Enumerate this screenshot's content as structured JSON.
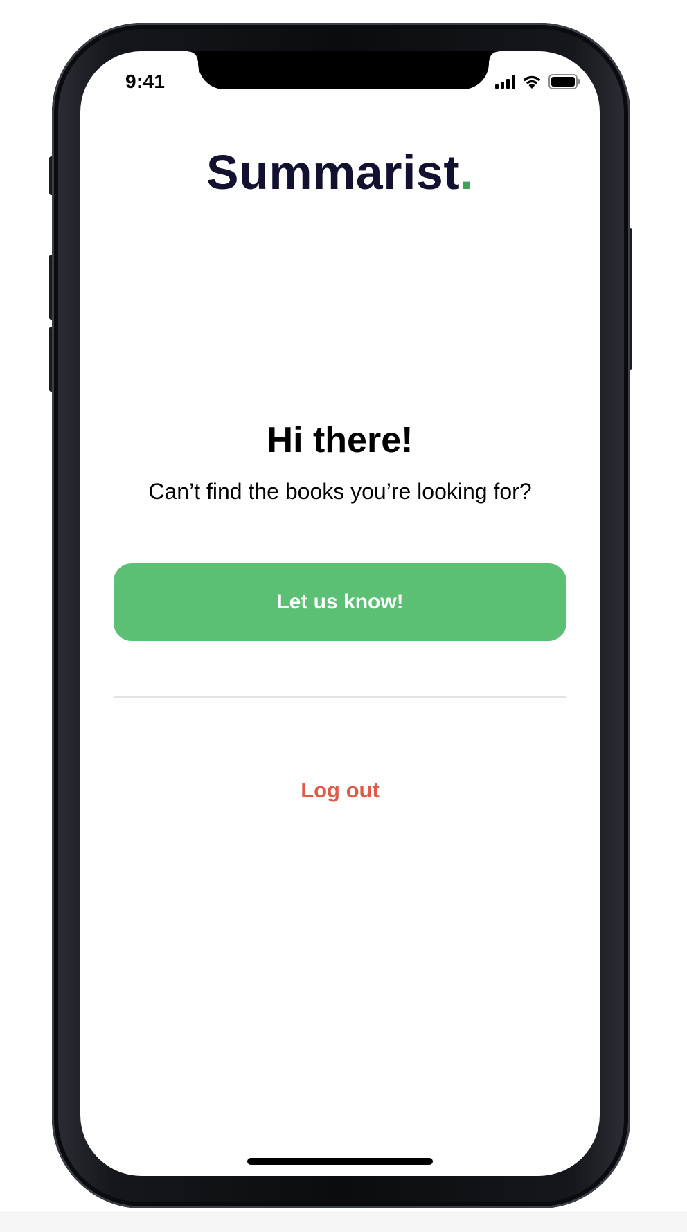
{
  "status_bar": {
    "time": "9:41",
    "icons": [
      "cellular-signal-icon",
      "wifi-icon",
      "battery-icon"
    ]
  },
  "brand": {
    "name": "Summarist",
    "dot": ".",
    "name_color": "#131130",
    "dot_color": "#3fa35b"
  },
  "main": {
    "greeting": "Hi there!",
    "subtitle": "Can’t find the books you’re looking for?",
    "cta_label": "Let us know!",
    "cta_color": "#5bc074",
    "logout_label": "Log out",
    "logout_color": "#e05a47"
  }
}
